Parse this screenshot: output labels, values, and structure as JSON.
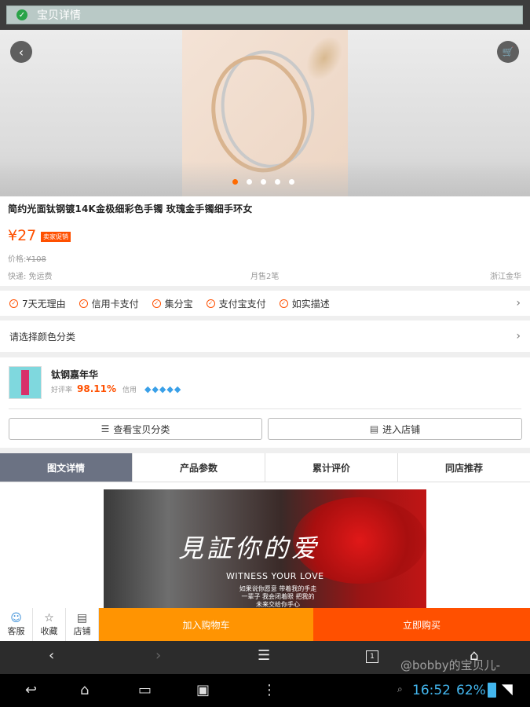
{
  "titlebar": {
    "title": "宝贝详情"
  },
  "hero": {
    "back_icon": "chevron-left-icon",
    "cart_icon": "cart-icon",
    "dot_count": 5,
    "active_dot": 0
  },
  "product": {
    "title": "简约光面钛钢镀14K金极细彩色手镯 玫瑰金手镯细手环女",
    "price": "¥27",
    "promo_badge": "卖家促销",
    "orig_label": "价格:",
    "orig_price": "¥108",
    "shipping": "快递: 免运费",
    "sales": "月售2笔",
    "location": "浙江金华"
  },
  "services": [
    "7天无理由",
    "信用卡支付",
    "集分宝",
    "支付宝支付",
    "如实描述"
  ],
  "color_select": {
    "label": "请选择颜色分类"
  },
  "shop": {
    "name": "钛钢嘉年华",
    "rating_label": "好评率",
    "rating_value": "98.11%",
    "credit_label": "信用",
    "diamonds": "💎💎💎💎💎",
    "btn_categories": "查看宝贝分类",
    "btn_enter": "进入店铺"
  },
  "tabs": [
    {
      "label": "图文详情",
      "active": true
    },
    {
      "label": "产品参数",
      "active": false
    },
    {
      "label": "累计评价",
      "active": false
    },
    {
      "label": "同店推荐",
      "active": false
    }
  ],
  "banner": {
    "headline": "見証你的爱",
    "english": "WITNESS YOUR LOVE",
    "poem": "如果说你愿意 带着我的手走一辈子 我会闭着眼 把我的未来交给你手心"
  },
  "actions": {
    "service": "客服",
    "favorite": "收藏",
    "store": "店铺",
    "add_cart": "加入购物车",
    "buy_now": "立即购买"
  },
  "browser_nav": {
    "tab_count": "1"
  },
  "watermark": "@bobby的宝贝儿-",
  "status": {
    "time": "16:52",
    "battery": "62%"
  },
  "colors": {
    "accent": "#ff5000",
    "cart_orange": "#ff9402",
    "tab_active": "#6b7283",
    "status_blue": "#43b6ee"
  }
}
